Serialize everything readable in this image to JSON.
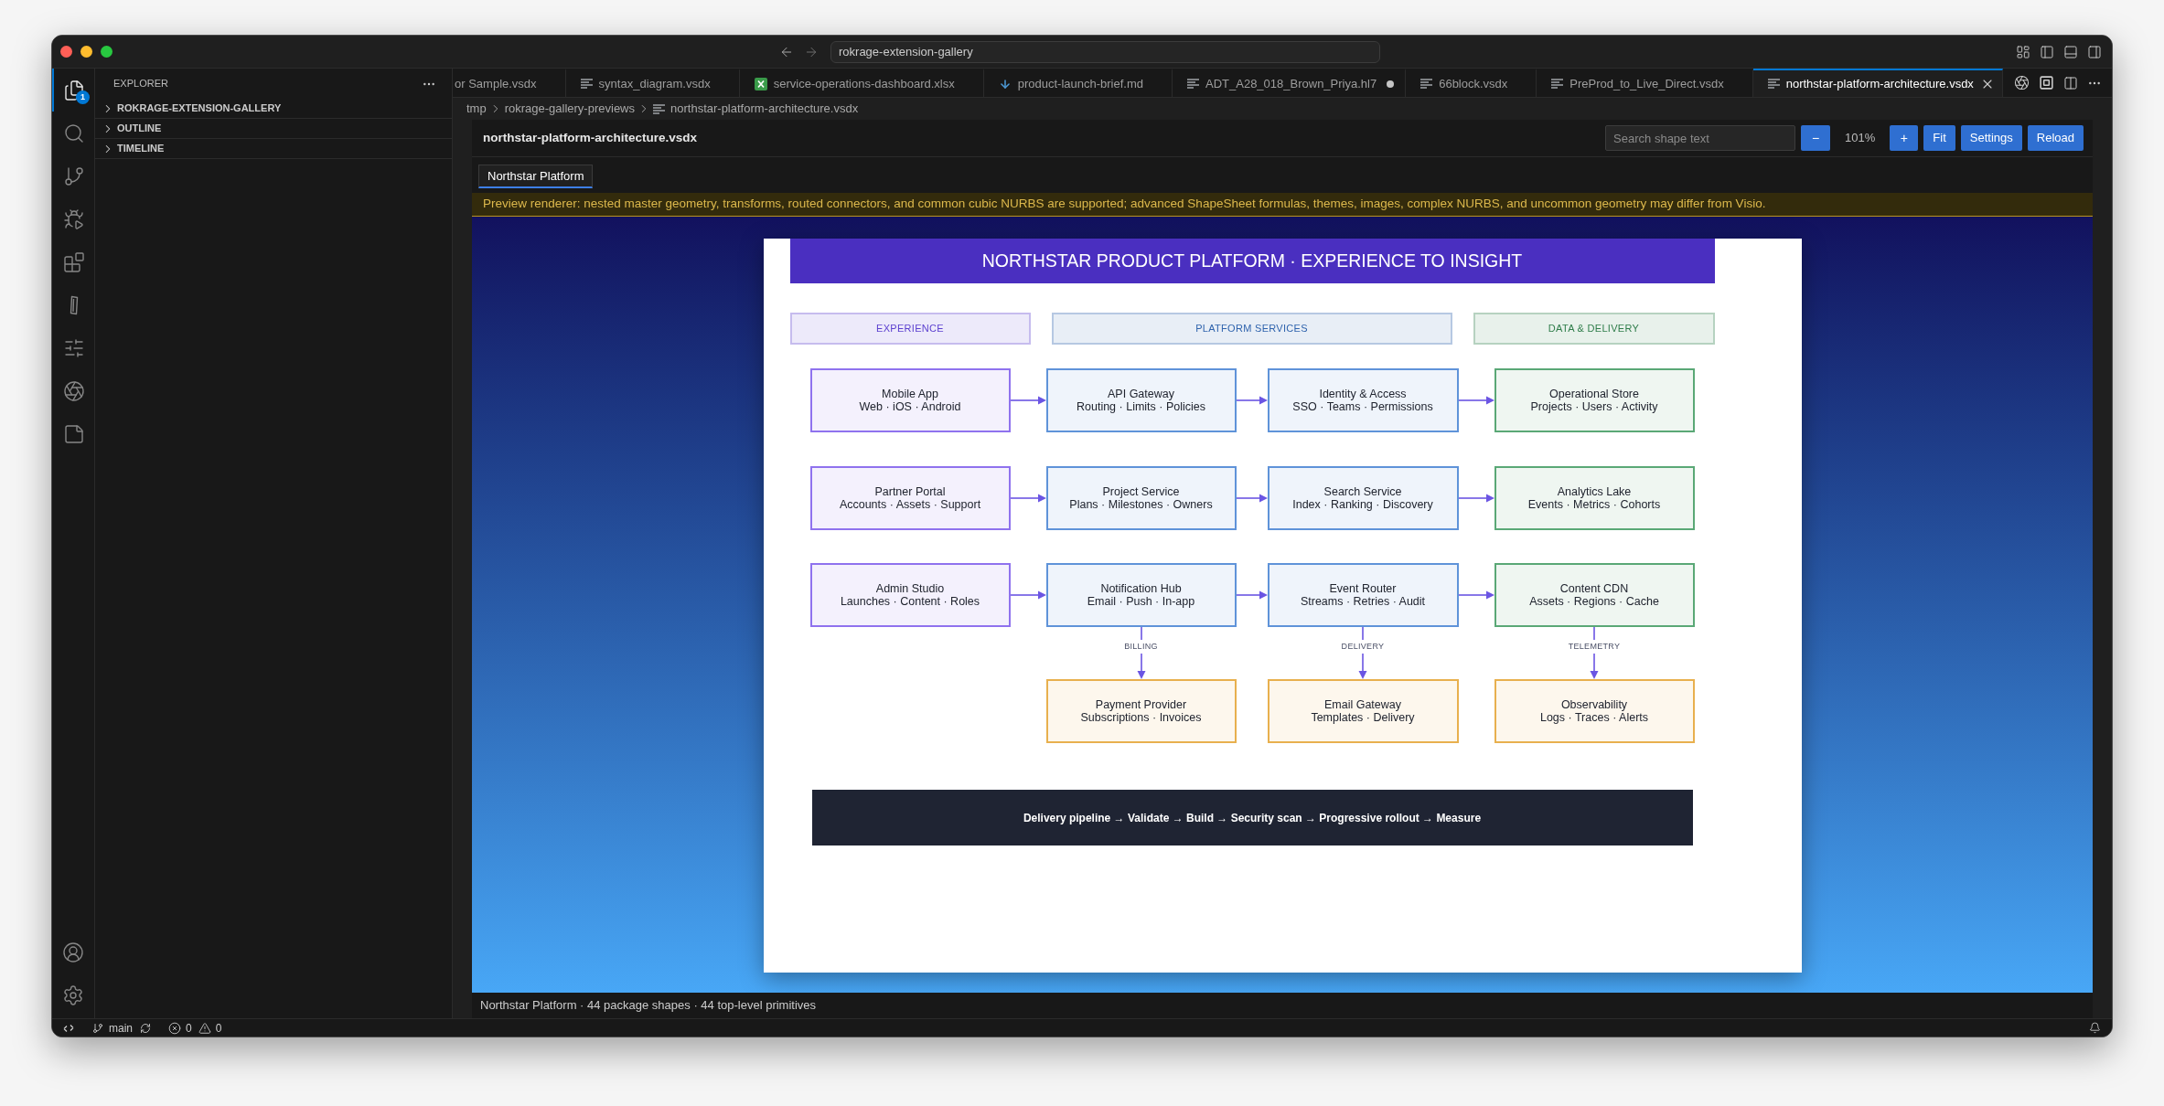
{
  "window": {
    "command_center": "rokrage-extension-gallery"
  },
  "activity_bar": {
    "items": [
      {
        "selected": true,
        "badge": "1"
      },
      {
        "selected": false
      },
      {
        "selected": false
      },
      {
        "selected": false
      },
      {
        "selected": false
      },
      {
        "selected": false
      },
      {
        "selected": false
      },
      {
        "selected": false
      },
      {
        "selected": false
      }
    ]
  },
  "sidebar": {
    "title": "EXPLORER",
    "sections": [
      {
        "label": "ROKRAGE-EXTENSION-GALLERY",
        "expanded": false
      },
      {
        "label": "OUTLINE",
        "expanded": false
      },
      {
        "label": "TIMELINE",
        "expanded": false
      }
    ]
  },
  "tabs": [
    {
      "label": "or Sample.vsdx",
      "kind": "clipped",
      "selected": false,
      "modified": false
    },
    {
      "label": "syntax_diagram.vsdx",
      "kind": "document",
      "selected": false,
      "modified": false
    },
    {
      "label": "service-operations-dashboard.xlsx",
      "kind": "spreadsheet",
      "selected": false,
      "modified": false
    },
    {
      "label": "product-launch-brief.md",
      "kind": "markdown",
      "selected": false,
      "modified": false
    },
    {
      "label": "ADT_A28_018_Brown_Priya.hl7",
      "kind": "document",
      "selected": false,
      "modified": true
    },
    {
      "label": "66block.vsdx",
      "kind": "document",
      "selected": false,
      "modified": false
    },
    {
      "label": "PreProd_to_Live_Direct.vsdx",
      "kind": "document",
      "selected": false,
      "modified": false
    },
    {
      "label": "northstar-platform-architecture.vsdx",
      "kind": "document",
      "selected": true,
      "modified": false
    }
  ],
  "breadcrumb": [
    "tmp",
    "rokrage-gallery-previews",
    "northstar-platform-architecture.vsdx"
  ],
  "preview": {
    "file_title": "northstar-platform-architecture.vsdx",
    "search": {
      "placeholder": "Search shape text"
    },
    "zoom_out": "−",
    "zoom": "101%",
    "zoom_in": "+",
    "buttons": [
      "Fit",
      "Settings",
      "Reload"
    ],
    "page_tabs": [
      {
        "label": "Northstar Platform",
        "selected": true
      }
    ],
    "notice": "Preview renderer: nested master geometry, transforms, routed connectors, and common cubic NURBS are supported; advanced ShapeSheet formulas, themes, images, complex NURBS, and uncommon geometry may differ from Visio.",
    "diagram": {
      "title": "NORTHSTAR PRODUCT PLATFORM · EXPERIENCE TO INSIGHT",
      "lanes": [
        {
          "label": "EXPERIENCE",
          "color": "#5b3fcf"
        },
        {
          "label": "PLATFORM SERVICES",
          "color": "#2f63ad"
        },
        {
          "label": "DATA & DELIVERY",
          "color": "#2f7d4a"
        }
      ],
      "rows": [
        {
          "chained": true,
          "nodes": [
            {
              "title": "Mobile App",
              "subtitle": "Web · iOS · Android",
              "color": "#8f72ee"
            },
            {
              "title": "API Gateway",
              "subtitle": "Routing · Limits · Policies",
              "color": "#5f93d9"
            },
            {
              "title": "Identity & Access",
              "subtitle": "SSO · Teams · Permissions",
              "color": "#5f93d9"
            },
            {
              "title": "Operational Store",
              "subtitle": "Projects · Users · Activity",
              "color": "#5aa876"
            }
          ]
        },
        {
          "chained": true,
          "nodes": [
            {
              "title": "Partner Portal",
              "subtitle": "Accounts · Assets · Support",
              "color": "#8f72ee"
            },
            {
              "title": "Project Service",
              "subtitle": "Plans · Milestones · Owners",
              "color": "#5f93d9"
            },
            {
              "title": "Search Service",
              "subtitle": "Index · Ranking · Discovery",
              "color": "#5f93d9"
            },
            {
              "title": "Analytics Lake",
              "subtitle": "Events · Metrics · Cohorts",
              "color": "#5aa876"
            }
          ]
        },
        {
          "chained": true,
          "nodes": [
            {
              "title": "Admin Studio",
              "subtitle": "Launches · Content · Roles",
              "color": "#8f72ee"
            },
            {
              "title": "Notification Hub",
              "subtitle": "Email · Push · In-app",
              "color": "#5f93d9"
            },
            {
              "title": "Event Router",
              "subtitle": "Streams · Retries · Audit",
              "color": "#5f93d9"
            },
            {
              "title": "Content CDN",
              "subtitle": "Assets · Regions · Cache",
              "color": "#5aa876"
            }
          ]
        },
        {
          "chained": false,
          "nodes": [
            {
              "title": "Payment Provider",
              "subtitle": "Subscriptions · Invoices",
              "color": "#e8b04e",
              "link_label": "BILLING"
            },
            {
              "title": "Email Gateway",
              "subtitle": "Templates · Delivery",
              "color": "#e8b04e",
              "link_label": "DELIVERY"
            },
            {
              "title": "Observability",
              "subtitle": "Logs · Traces · Alerts",
              "color": "#e8b04e",
              "link_label": "TELEMETRY"
            }
          ]
        }
      ],
      "pipeline": "Delivery pipeline → Validate → Build → Security scan → Progressive rollout → Measure"
    },
    "info": "Northstar Platform · 44 package shapes · 44 top-level primitives"
  },
  "status_bar": {
    "branch": "main",
    "errors": "0",
    "warnings": "0"
  }
}
